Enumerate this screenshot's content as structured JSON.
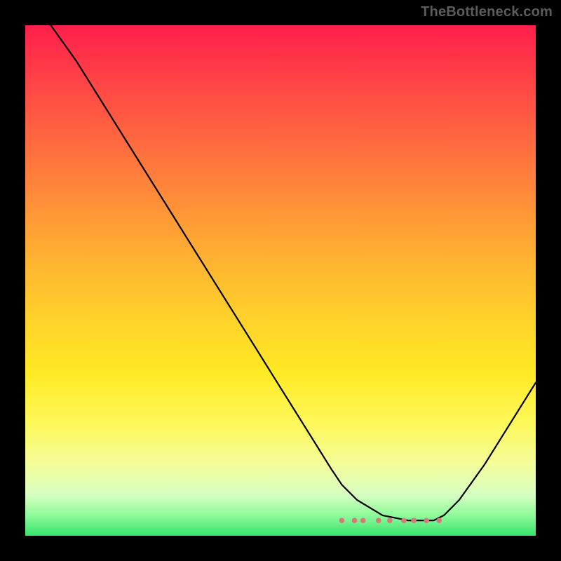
{
  "watermark": "TheBottleneck.com",
  "colors": {
    "background": "#000000",
    "gradient_top": "#ff1f4a",
    "gradient_bottom": "#36e36e",
    "curve_stroke": "#000000",
    "dots_stroke": "#d47a78",
    "watermark_text": "#5b5b5b"
  },
  "chart_data": {
    "type": "line",
    "title": "",
    "xlabel": "",
    "ylabel": "",
    "xlim": [
      0,
      100
    ],
    "ylim": [
      0,
      100
    ],
    "grid": false,
    "legend": false,
    "series": [
      {
        "name": "bottleneck-curve",
        "x": [
          5,
          10,
          15,
          20,
          25,
          30,
          35,
          40,
          45,
          50,
          55,
          60,
          62,
          65,
          70,
          75,
          80,
          82,
          85,
          90,
          95,
          100
        ],
        "y": [
          100,
          93,
          85,
          77,
          69,
          61,
          53,
          45,
          37,
          29,
          21,
          13,
          10,
          7,
          4,
          3,
          3,
          4,
          7,
          14,
          22,
          30
        ]
      }
    ],
    "annotations": [
      {
        "name": "valley-dots",
        "type": "marker-strip",
        "x_range": [
          62,
          82
        ],
        "y": 3,
        "color": "#d47a78"
      }
    ],
    "background_gradient": {
      "direction": "vertical",
      "stops": [
        {
          "pos": 0,
          "color": "#ff1f4a"
        },
        {
          "pos": 0.5,
          "color": "#ffd32a"
        },
        {
          "pos": 0.85,
          "color": "#f4fd9a"
        },
        {
          "pos": 1,
          "color": "#36e36e"
        }
      ]
    }
  }
}
